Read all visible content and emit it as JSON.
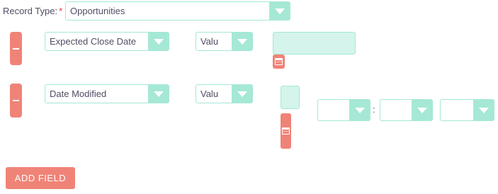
{
  "record_type": {
    "label": "Record Type:",
    "required_marker": "*",
    "selected": "Opportunities"
  },
  "conditions": [
    {
      "field": "Expected Close Date",
      "operator": "Valu",
      "value_type": "date"
    },
    {
      "field": "Date Modified",
      "operator": "Valu",
      "value_type": "datetime",
      "hours": "",
      "minutes": "",
      "meridiem": "",
      "time_separator": ":"
    }
  ],
  "add_field_label": "ADD FIELD",
  "colors": {
    "accent": "#a5e8d6",
    "input_fill": "#d4f4ec",
    "danger": "#f08377",
    "text": "#534d64"
  }
}
